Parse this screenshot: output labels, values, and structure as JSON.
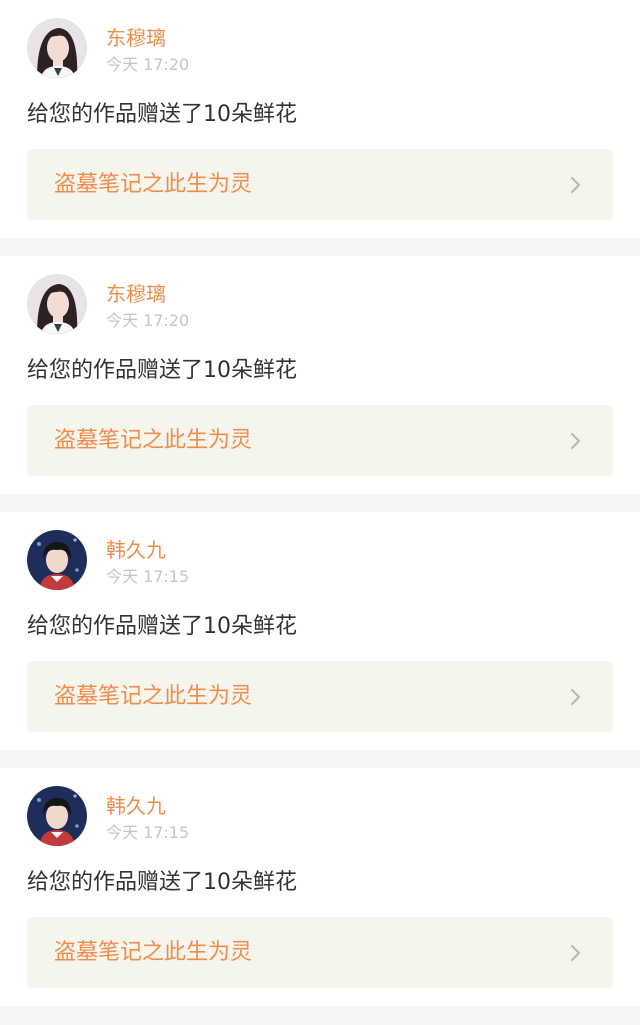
{
  "colors": {
    "accent": "#f08d4b",
    "timestamp": "#c4c4c4",
    "card_link_bg": "#f5f5ee",
    "page_bg": "#f6f6f6"
  },
  "notifications": [
    {
      "user": "东穆璃",
      "time": "今天 17:20",
      "message": "给您的作品赠送了10朵鲜花",
      "work_title": "盗墓笔记之此生为灵",
      "avatar_icon": "female-user-avatar-icon"
    },
    {
      "user": "东穆璃",
      "time": "今天 17:20",
      "message": "给您的作品赠送了10朵鲜花",
      "work_title": "盗墓笔记之此生为灵",
      "avatar_icon": "female-user-avatar-icon"
    },
    {
      "user": "韩久九",
      "time": "今天 17:15",
      "message": "给您的作品赠送了10朵鲜花",
      "work_title": "盗墓笔记之此生为灵",
      "avatar_icon": "male-user-avatar-icon"
    },
    {
      "user": "韩久九",
      "time": "今天 17:15",
      "message": "给您的作品赠送了10朵鲜花",
      "work_title": "盗墓笔记之此生为灵",
      "avatar_icon": "male-user-avatar-icon"
    }
  ]
}
